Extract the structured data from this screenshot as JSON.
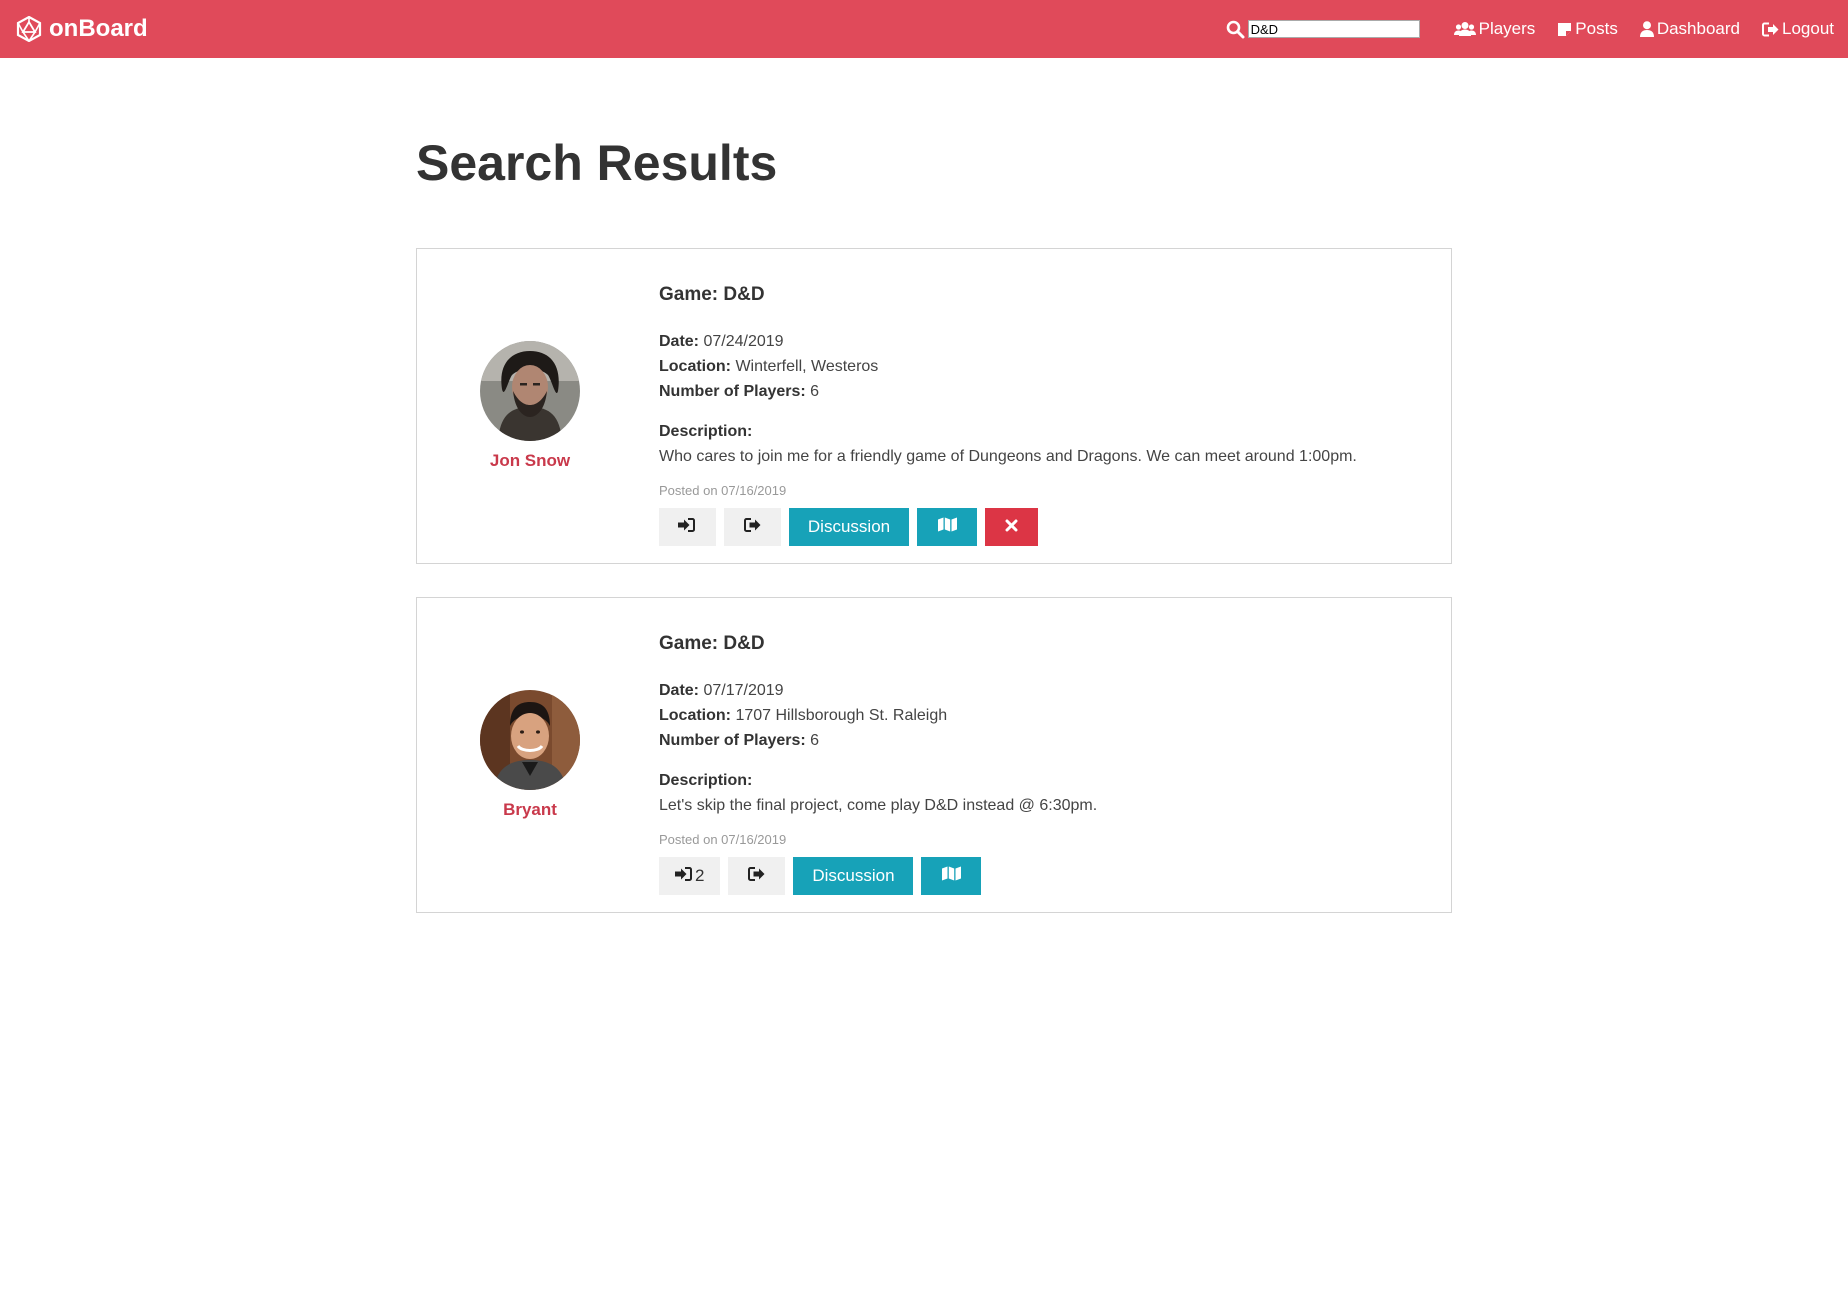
{
  "navbar": {
    "brand": "onBoard",
    "brand_icon": "d20-dice-icon",
    "search": {
      "value": "D&D",
      "icon": "search-icon"
    },
    "links": [
      {
        "label": "Players",
        "icon": "users-icon"
      },
      {
        "label": "Posts",
        "icon": "note-icon"
      },
      {
        "label": "Dashboard",
        "icon": "user-icon"
      },
      {
        "label": "Logout",
        "icon": "sign-out-icon"
      }
    ],
    "color": "#e04a5a"
  },
  "page": {
    "title": "Search Results"
  },
  "results": [
    {
      "author": "Jon Snow",
      "game_label": "Game:",
      "game": "D&D",
      "date_label": "Date:",
      "date": "07/24/2019",
      "location_label": "Location:",
      "location": "Winterfell, Westeros",
      "players_label": "Number of Players:",
      "players": "6",
      "description_label": "Description:",
      "description": "Who cares to join me for a friendly game of Dungeons and Dragons. We can meet around 1:00pm.",
      "posted": "Posted on 07/16/2019",
      "join_count": "",
      "buttons": {
        "discussion": "Discussion",
        "has_delete": true
      }
    },
    {
      "author": "Bryant",
      "game_label": "Game:",
      "game": "D&D",
      "date_label": "Date:",
      "date": "07/17/2019",
      "location_label": "Location:",
      "location": "1707 Hillsborough St. Raleigh",
      "players_label": "Number of Players:",
      "players": "6",
      "description_label": "Description:",
      "description": "Let's skip the final project, come play D&D instead @ 6:30pm.",
      "posted": "Posted on 07/16/2019",
      "join_count": "2",
      "buttons": {
        "discussion": "Discussion",
        "has_delete": false
      }
    }
  ],
  "colors": {
    "accent": "#e04a5a",
    "author": "#c9394b",
    "teal": "#17a2b8",
    "danger": "#dc3545"
  }
}
